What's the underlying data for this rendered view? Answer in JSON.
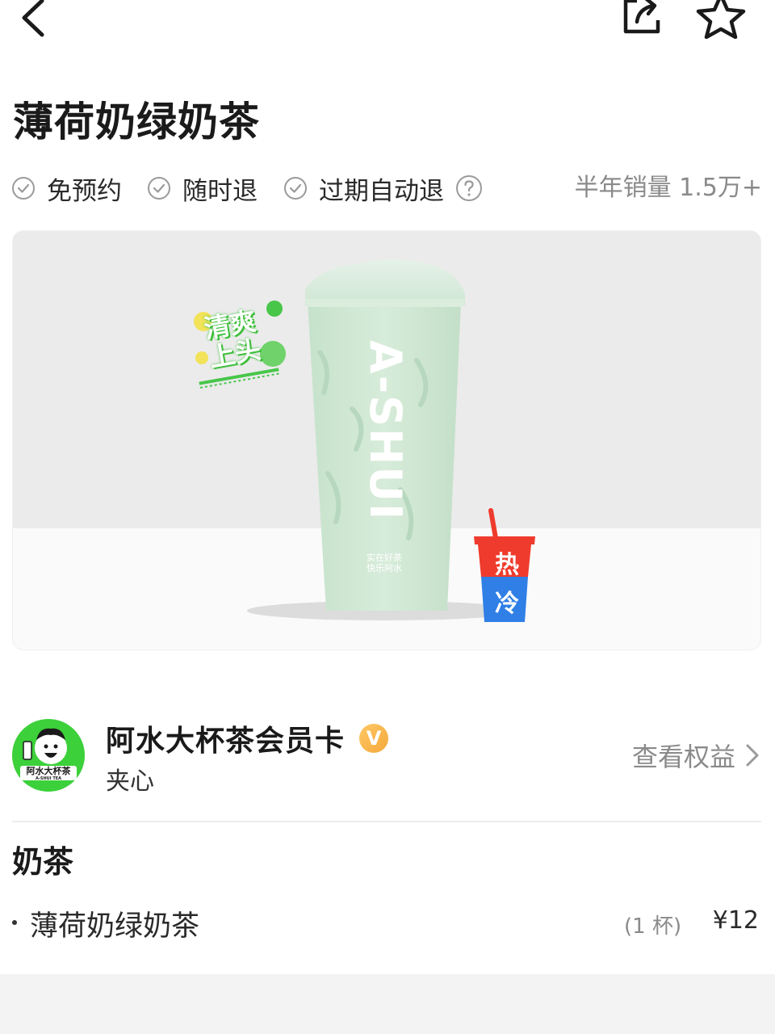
{
  "header": {
    "back_icon": "chevron-left-icon",
    "share_icon": "share-icon",
    "favorite_icon": "star-icon"
  },
  "product": {
    "title": "薄荷奶绿奶茶",
    "guarantees": [
      "免预约",
      "随时退",
      "过期自动退"
    ],
    "help_icon": "question-circle-icon",
    "sales": "半年销量 1.5万+",
    "image": {
      "cup_brand": "A-SHUI",
      "cup_slogan_line1": "实在好茶",
      "cup_slogan_line2": "快乐阿水",
      "sticker_line1": "清爽",
      "sticker_line2": "上头",
      "hot_label": "热",
      "cold_label": "冷"
    }
  },
  "merchant": {
    "name": "阿水大杯茶会员卡",
    "badge": "V",
    "subtitle": "夹心",
    "logo_text": "阿水大杯茶",
    "logo_subtext": "A-SHUI TEA",
    "rights_label": "查看权益"
  },
  "package": {
    "section_title": "奶茶",
    "items": [
      {
        "name": "薄荷奶绿奶茶",
        "quantity": "(1 杯)",
        "price": "¥12"
      }
    ]
  },
  "colors": {
    "brand_green": "#3cd03a",
    "badge_orange": "#f4a93a",
    "hot_red": "#ef3b2d",
    "cold_blue": "#2f7fe6",
    "mint": "#cfe6d4"
  }
}
